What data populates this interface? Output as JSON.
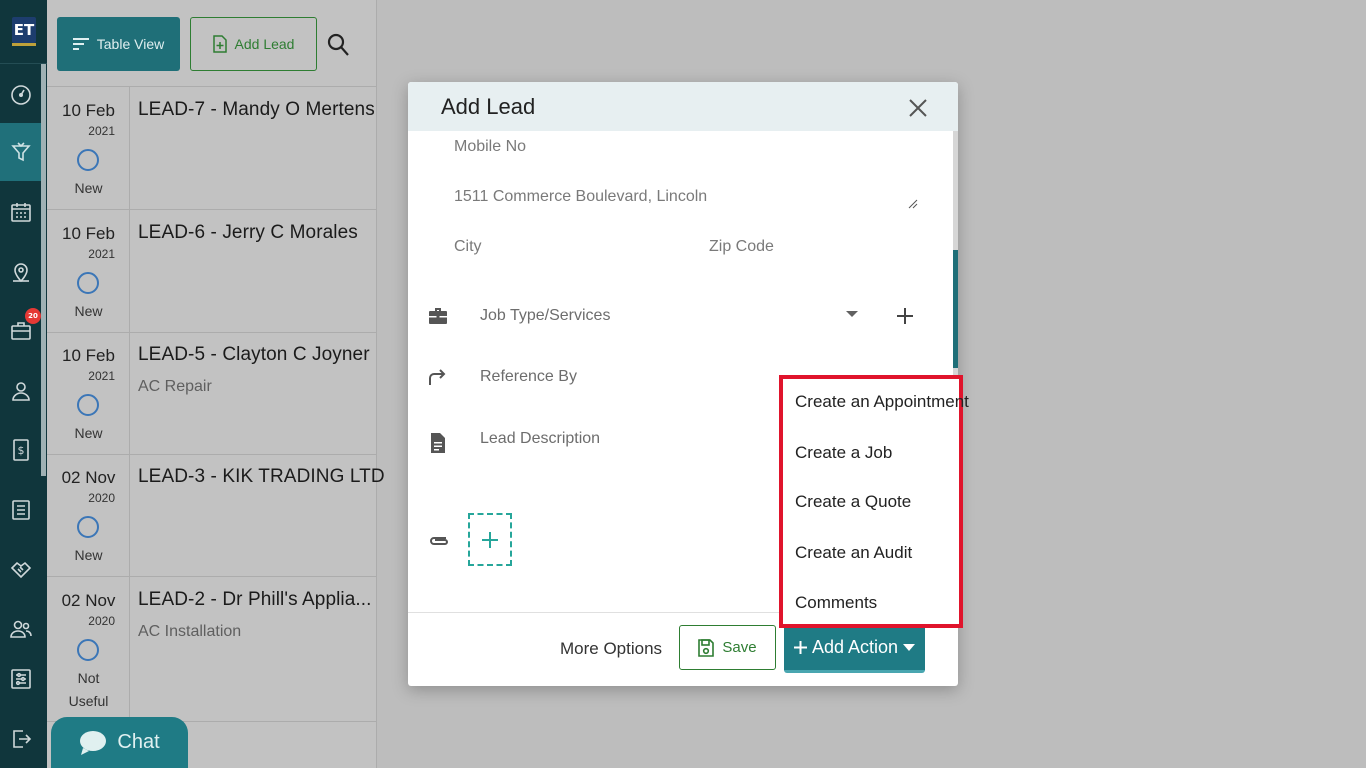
{
  "app": {
    "logo_text": "ET",
    "notification_count": "20"
  },
  "toolbar": {
    "table_view_label": "Table View",
    "add_lead_label": "Add Lead"
  },
  "leads": [
    {
      "day": "10 Feb",
      "year": "2021",
      "title": "LEAD-7 - Mandy O Mertens",
      "subtitle": "",
      "status": "New"
    },
    {
      "day": "10 Feb",
      "year": "2021",
      "title": "LEAD-6 - Jerry C Morales",
      "subtitle": "",
      "status": "New"
    },
    {
      "day": "10 Feb",
      "year": "2021",
      "title": "LEAD-5 - Clayton C Joyner",
      "subtitle": "AC Repair",
      "status": "New"
    },
    {
      "day": "02 Nov",
      "year": "2020",
      "title": "LEAD-3 - KIK TRADING LTD",
      "subtitle": "",
      "status": "New"
    },
    {
      "day": "02 Nov",
      "year": "2020",
      "title": "LEAD-2 - Dr Phill's Applia...",
      "subtitle": "AC Installation",
      "status_line1": "Not",
      "status_line2": "Useful"
    }
  ],
  "chat": {
    "label": "Chat"
  },
  "modal": {
    "title": "Add Lead",
    "fields": {
      "mobile_placeholder": "Mobile No",
      "address_value": "1511  Commerce Boulevard, Lincoln",
      "city_placeholder": "City",
      "zip_placeholder": "Zip Code",
      "job_type_placeholder": "Job Type/Services",
      "reference_placeholder": "Reference By",
      "description_placeholder": "Lead Description"
    },
    "footer": {
      "more_options_label": "More Options",
      "save_label": "Save",
      "add_action_label": "Add Action"
    }
  },
  "add_action_menu": {
    "items": [
      "Create an Appointment",
      "Create a Job",
      "Create a Quote",
      "Create an Audit",
      "Comments"
    ]
  },
  "colors": {
    "sidebar_bg": "#10363c",
    "accent_teal": "#1f6f78",
    "success_green": "#2e7d32",
    "highlight_red": "#e0142c",
    "status_blue": "#3b76b7"
  },
  "icons": [
    "gauge-icon",
    "funnel-icon",
    "calendar-icon",
    "map-pin-icon",
    "briefcase-icon",
    "user-icon",
    "invoice-dollar-icon",
    "list-icon",
    "handshake-icon",
    "users-icon",
    "settings-sliders-icon",
    "logout-icon"
  ]
}
